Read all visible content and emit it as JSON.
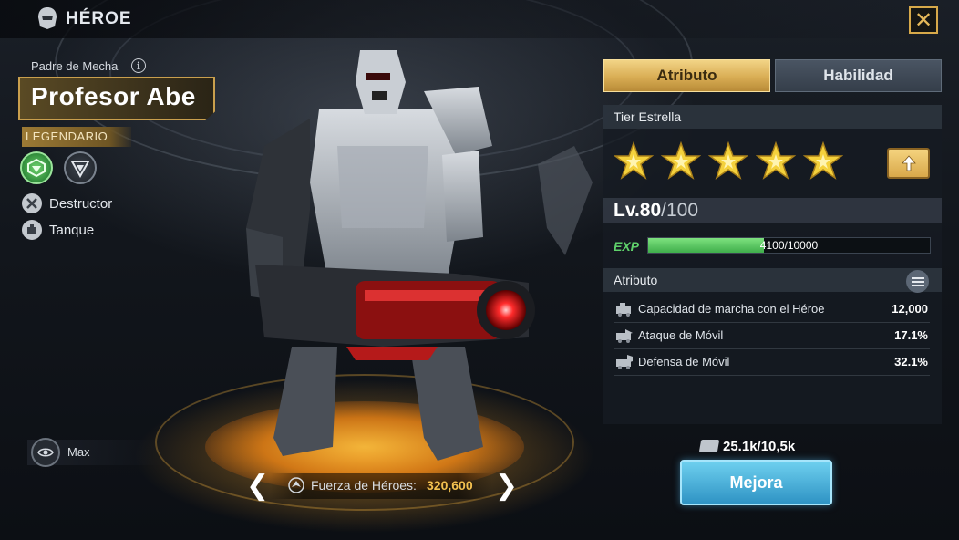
{
  "header": {
    "title": "HÉROE",
    "title_icon": "helmet-icon",
    "close_icon": "close-icon"
  },
  "hero": {
    "category_label": "Padre de Mecha",
    "name": "Profesor Abe",
    "rarity": "LEGENDARIO",
    "roles": [
      {
        "icon": "destroyer-icon",
        "label": "Destructor"
      },
      {
        "icon": "tank-icon",
        "label": "Tanque"
      }
    ]
  },
  "view": {
    "label": "Max"
  },
  "power": {
    "label": "Fuerza de Héroes:",
    "value": "320,600"
  },
  "tabs": [
    {
      "label": "Atributo",
      "active": true
    },
    {
      "label": "Habilidad",
      "active": false
    }
  ],
  "stars": {
    "title": "Tier Estrella",
    "count": 5,
    "max": 5
  },
  "level": {
    "prefix": "Lv.",
    "current": "80",
    "max": "/100"
  },
  "exp": {
    "label": "EXP",
    "text": "4100/10000",
    "fraction": 0.41
  },
  "attributes": {
    "title": "Atributo",
    "rows": [
      {
        "label": "Capacidad de marcha con el Héroe",
        "value": "12,000"
      },
      {
        "label": "Ataque de Móvil",
        "value": "17.1%"
      },
      {
        "label": "Defensa de Móvil",
        "value": "32.1%"
      }
    ]
  },
  "upgrade": {
    "cost": "25.1k/10,5k",
    "button": "Mejora"
  },
  "colors": {
    "gold": "#d9ad54",
    "accent_blue": "#2f93c4",
    "exp_green": "#3fae4b",
    "power_gold": "#f3c04f"
  }
}
